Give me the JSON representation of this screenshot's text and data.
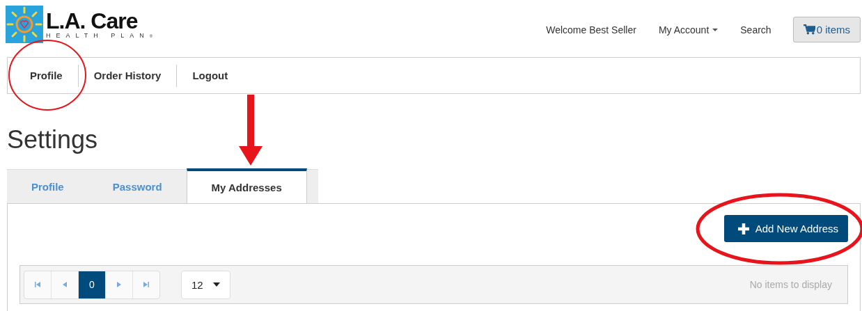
{
  "logo": {
    "name": "L.A. Care",
    "tagline": "HEALTH PLAN",
    "mark": "®"
  },
  "header_links": [
    {
      "kind": "text",
      "label": "Welcome Best Seller"
    },
    {
      "kind": "dropdown",
      "label": "My Account"
    },
    {
      "kind": "link",
      "label": "Search"
    }
  ],
  "cart": {
    "label": "0 items"
  },
  "nav": [
    {
      "label": "Profile"
    },
    {
      "label": "Order History"
    },
    {
      "label": "Logout"
    }
  ],
  "page_title": "Settings",
  "tabs": [
    {
      "label": "Profile",
      "selected": false
    },
    {
      "label": "Password",
      "selected": false
    },
    {
      "label": "My Addresses",
      "selected": true
    }
  ],
  "add_button": {
    "label": "Add New Address"
  },
  "pager": {
    "current_page": "0",
    "page_size": "12",
    "status": "No items to display"
  }
}
